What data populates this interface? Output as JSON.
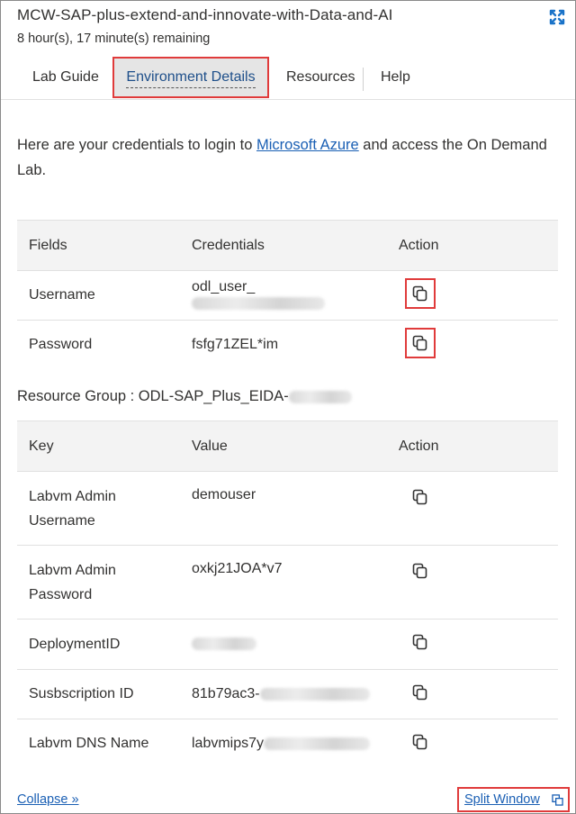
{
  "header": {
    "title": "MCW-SAP-plus-extend-and-innovate-with-Data-and-AI",
    "timer": "8 hour(s), 17 minute(s) remaining"
  },
  "tabs": [
    {
      "label": "Lab Guide",
      "active": false
    },
    {
      "label": "Environment Details",
      "active": true
    },
    {
      "label": "Resources",
      "active": false
    },
    {
      "label": "Help",
      "active": false
    }
  ],
  "intro": {
    "before": "Here are your credentials to login to ",
    "link": "Microsoft Azure",
    "after": " and access the On Demand Lab."
  },
  "credentials_table": {
    "headers": [
      "Fields",
      "Credentials",
      "Action"
    ],
    "rows": [
      {
        "field": "Username",
        "value": "odl_user_"
      },
      {
        "field": "Password",
        "value": "fsfg71ZEL*im"
      }
    ]
  },
  "resource_group": {
    "label": "Resource Group : ODL-SAP_Plus_EIDA-"
  },
  "resources_table": {
    "headers": [
      "Key",
      "Value",
      "Action"
    ],
    "rows": [
      {
        "key": "Labvm Admin Username",
        "value": "demouser"
      },
      {
        "key": "Labvm Admin Password",
        "value": "oxkj21JOA*v7"
      },
      {
        "key": "DeploymentID",
        "value": ""
      },
      {
        "key": "Susbscription ID",
        "value": "81b79ac3-"
      },
      {
        "key": "Labvm DNS Name",
        "value": "labvmips7y"
      }
    ]
  },
  "footer": {
    "collapse": "Collapse »",
    "split": "Split Window"
  },
  "colors": {
    "link": "#1a5fb4",
    "highlight": "#e03b3b",
    "active_tab_bg": "#e5e5e5"
  }
}
